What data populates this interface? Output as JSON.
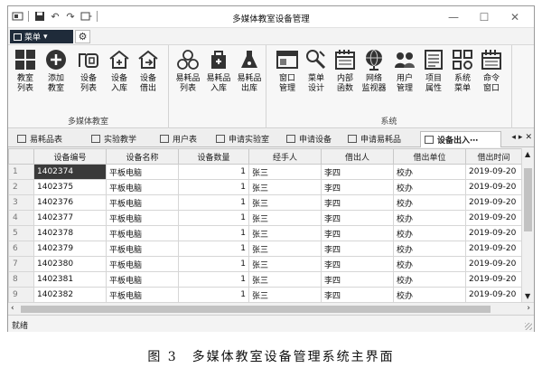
{
  "window": {
    "title": "多媒体教室设备管理",
    "qat_icons": [
      "app-icon",
      "save-icon",
      "undo-icon",
      "redo-icon",
      "customize-icon"
    ],
    "controls": {
      "minimize": "—",
      "maximize": "☐",
      "close": "✕"
    }
  },
  "menu": {
    "label": "菜单",
    "caret": "▾"
  },
  "ribbon": {
    "groups": [
      {
        "label": "多媒体教室",
        "buttons": [
          {
            "label": "教室\n列表",
            "icon": "grid-icon"
          },
          {
            "label": "添加\n教室",
            "icon": "add-icon"
          },
          {
            "label": "设备\n列表",
            "icon": "device-list-icon"
          },
          {
            "label": "设备\n入库",
            "icon": "device-in-icon"
          },
          {
            "label": "设备\n借出",
            "icon": "device-out-icon"
          }
        ]
      },
      {
        "label": "",
        "buttons": [
          {
            "label": "易耗品\n列表",
            "icon": "consumables-icon"
          },
          {
            "label": "易耗品\n入库",
            "icon": "consumables-in-icon"
          },
          {
            "label": "易耗品\n出库",
            "icon": "consumables-out-icon"
          }
        ]
      },
      {
        "label": "系统",
        "buttons": [
          {
            "label": "窗口\n管理",
            "icon": "window-icon"
          },
          {
            "label": "菜单\n设计",
            "icon": "menu-design-icon"
          },
          {
            "label": "内部\n函数",
            "icon": "function-icon"
          },
          {
            "label": "网络\n监视器",
            "icon": "network-icon"
          },
          {
            "label": "用户\n管理",
            "icon": "users-icon"
          },
          {
            "label": "项目\n属性",
            "icon": "properties-icon"
          },
          {
            "label": "系统\n菜单",
            "icon": "system-menu-icon"
          },
          {
            "label": "命令\n窗口",
            "icon": "command-icon"
          }
        ]
      }
    ]
  },
  "tabs": [
    {
      "label": "易耗品表"
    },
    {
      "label": "实验教学"
    },
    {
      "label": "用户表"
    },
    {
      "label": "申请实验室"
    },
    {
      "label": "申请设备"
    },
    {
      "label": "申请易耗品"
    },
    {
      "label": "设备出入⋯",
      "active": true
    }
  ],
  "tab_nav": {
    "prev": "◂",
    "next": "▸",
    "close": "✕"
  },
  "grid": {
    "columns": [
      "设备编号",
      "设备名称",
      "设备数量",
      "经手人",
      "借出人",
      "借出单位",
      "借出时间"
    ],
    "rows": [
      {
        "n": "1",
        "id": "1402374",
        "name": "平板电脑",
        "qty": "1",
        "handler": "张三",
        "borrower": "李四",
        "unit": "校办",
        "time": "2019-09-20"
      },
      {
        "n": "2",
        "id": "1402375",
        "name": "平板电脑",
        "qty": "1",
        "handler": "张三",
        "borrower": "李四",
        "unit": "校办",
        "time": "2019-09-20"
      },
      {
        "n": "3",
        "id": "1402376",
        "name": "平板电脑",
        "qty": "1",
        "handler": "张三",
        "borrower": "李四",
        "unit": "校办",
        "time": "2019-09-20"
      },
      {
        "n": "4",
        "id": "1402377",
        "name": "平板电脑",
        "qty": "1",
        "handler": "张三",
        "borrower": "李四",
        "unit": "校办",
        "time": "2019-09-20"
      },
      {
        "n": "5",
        "id": "1402378",
        "name": "平板电脑",
        "qty": "1",
        "handler": "张三",
        "borrower": "李四",
        "unit": "校办",
        "time": "2019-09-20"
      },
      {
        "n": "6",
        "id": "1402379",
        "name": "平板电脑",
        "qty": "1",
        "handler": "张三",
        "borrower": "李四",
        "unit": "校办",
        "time": "2019-09-20"
      },
      {
        "n": "7",
        "id": "1402380",
        "name": "平板电脑",
        "qty": "1",
        "handler": "张三",
        "borrower": "李四",
        "unit": "校办",
        "time": "2019-09-20"
      },
      {
        "n": "8",
        "id": "1402381",
        "name": "平板电脑",
        "qty": "1",
        "handler": "张三",
        "borrower": "李四",
        "unit": "校办",
        "time": "2019-09-20"
      },
      {
        "n": "9",
        "id": "1402382",
        "name": "平板电脑",
        "qty": "1",
        "handler": "张三",
        "borrower": "李四",
        "unit": "校办",
        "time": "2019-09-20"
      }
    ]
  },
  "status": "就绪",
  "caption": "图 3　多媒体教室设备管理系统主界面",
  "colors": {
    "menu_bg": "#1f2b3a",
    "selected_cell": "#3a3a3a"
  }
}
